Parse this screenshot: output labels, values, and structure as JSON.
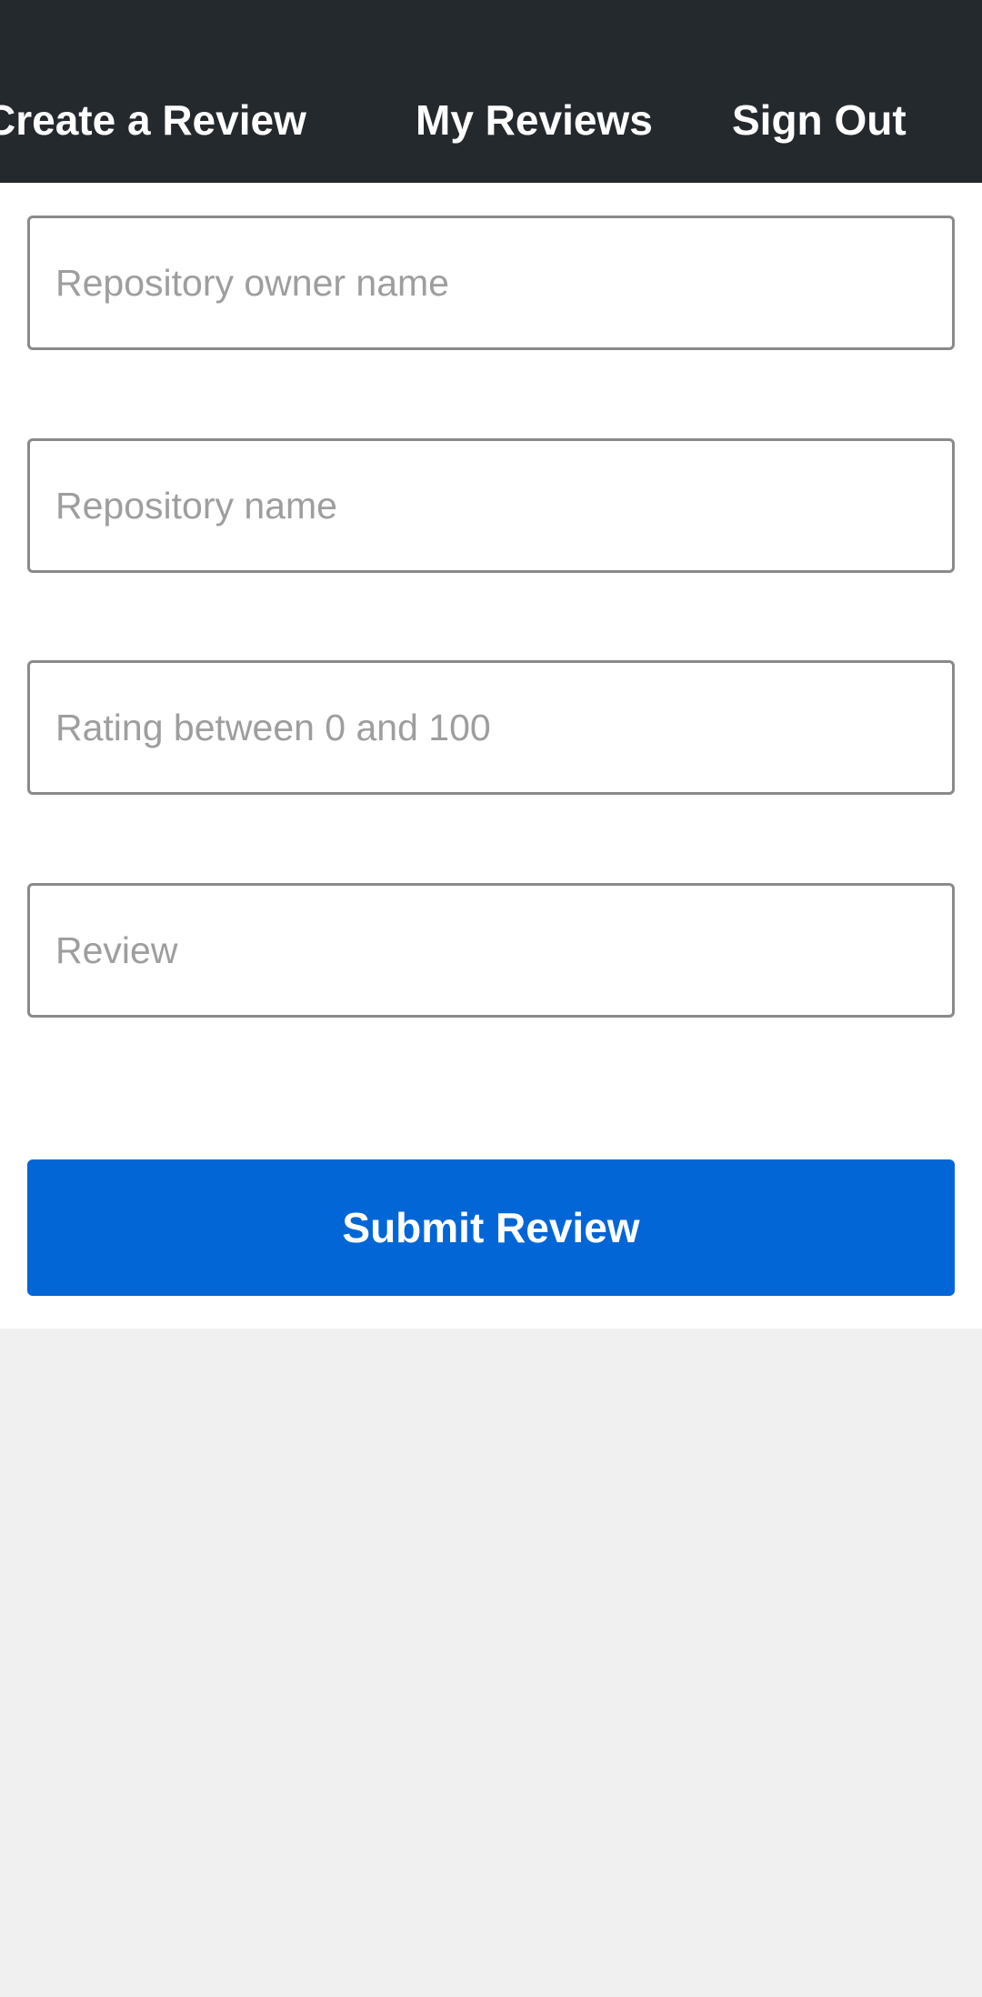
{
  "app_bar": {
    "tabs": [
      {
        "label": "Create a Review"
      },
      {
        "label": "My Reviews"
      },
      {
        "label": "Sign Out"
      }
    ]
  },
  "form": {
    "fields": [
      {
        "placeholder": "Repository owner name",
        "value": ""
      },
      {
        "placeholder": "Repository name",
        "value": ""
      },
      {
        "placeholder": "Rating between 0 and 100",
        "value": ""
      },
      {
        "placeholder": "Review",
        "value": ""
      }
    ],
    "submit_label": "Submit Review"
  },
  "colors": {
    "app_bar_background": "#24292e",
    "primary_button": "#0366d6",
    "page_background": "#f0f0f0",
    "input_border": "#8a8a8a",
    "placeholder_text": "#9e9e9e"
  }
}
